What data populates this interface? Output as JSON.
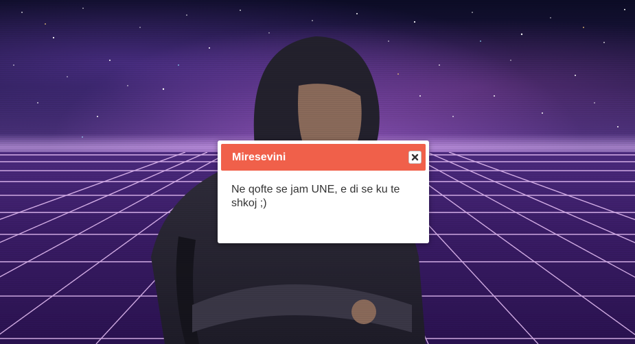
{
  "modal": {
    "title": "Miresevini",
    "message": "Ne qofte se jam UNE, e di se ku te shkoj ;)",
    "close_icon": "close-icon",
    "header_color": "#f0604a"
  },
  "background": {
    "theme": "synthwave purple grid with starry sky",
    "grid_color": "#f0c8ff"
  }
}
